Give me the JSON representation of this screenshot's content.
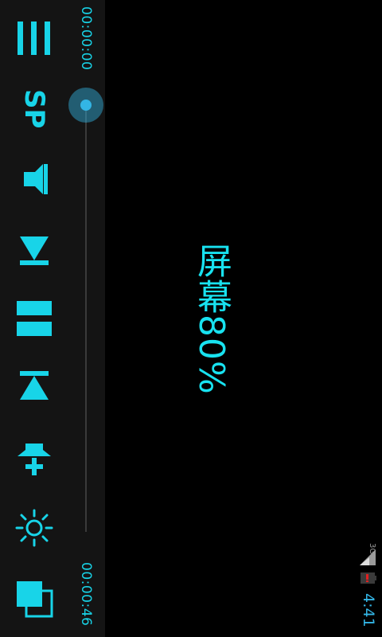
{
  "player": {
    "elapsed_time": "00:00:00",
    "total_time": "00:00:46",
    "progress": 0.0,
    "speed_label": "SP"
  },
  "controls": {
    "buttons": [
      {
        "icon": "menu-icon"
      },
      {
        "icon": "speed-label"
      },
      {
        "icon": "volume-down-icon"
      },
      {
        "icon": "previous-icon"
      },
      {
        "icon": "pause-icon"
      },
      {
        "icon": "next-icon"
      },
      {
        "icon": "volume-up-icon"
      },
      {
        "icon": "brightness-icon"
      },
      {
        "icon": "screen-size-icon"
      }
    ]
  },
  "osd": {
    "text": "屏幕80%"
  },
  "status_bar": {
    "network_type": "3G",
    "time": "4:41"
  },
  "colors": {
    "accent": "#18d4e8",
    "holo_blue": "#33b5e5",
    "bar_background": "#141414"
  }
}
